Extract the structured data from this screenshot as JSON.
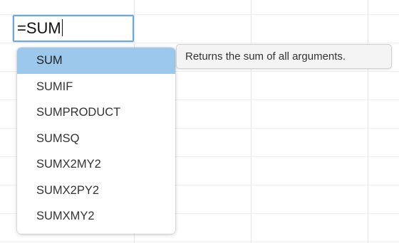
{
  "formula_input": {
    "value": "=SUM"
  },
  "autocomplete": {
    "items": [
      {
        "label": "SUM",
        "selected": true
      },
      {
        "label": "SUMIF",
        "selected": false
      },
      {
        "label": "SUMPRODUCT",
        "selected": false
      },
      {
        "label": "SUMSQ",
        "selected": false
      },
      {
        "label": "SUMX2MY2",
        "selected": false
      },
      {
        "label": "SUMX2PY2",
        "selected": false
      },
      {
        "label": "SUMXMY2",
        "selected": false
      }
    ]
  },
  "tooltip": {
    "text": "Returns the sum of all arguments."
  },
  "colors": {
    "selection": "#9cc8ec",
    "editor_border": "#6aa8e4"
  }
}
